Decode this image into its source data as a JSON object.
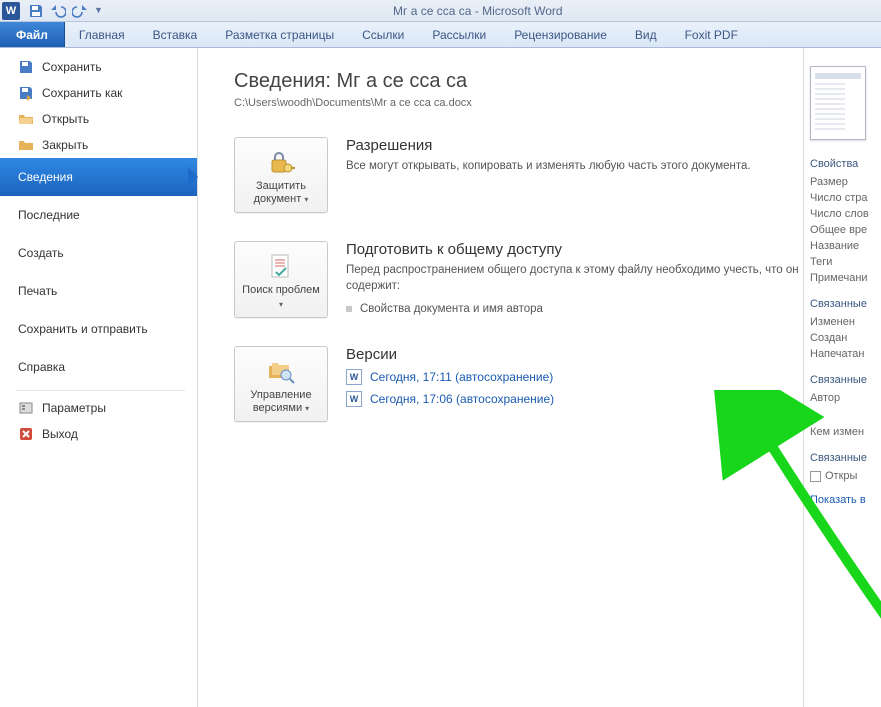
{
  "title": "Мг а се  сса са  -  Microsoft Word",
  "ribbon": {
    "file": "Файл",
    "tabs": [
      "Главная",
      "Вставка",
      "Разметка страницы",
      "Ссылки",
      "Рассылки",
      "Рецензирование",
      "Вид",
      "Foxit PDF"
    ]
  },
  "sidebar": {
    "save": "Сохранить",
    "saveas": "Сохранить как",
    "open": "Открыть",
    "close": "Закрыть",
    "info": "Сведения",
    "recent": "Последние",
    "new": "Создать",
    "print": "Печать",
    "share": "Сохранить и отправить",
    "help": "Справка",
    "options": "Параметры",
    "exit": "Выход"
  },
  "main": {
    "title": "Сведения: Мг а се  сса са",
    "path": "C:\\Users\\woodh\\Documents\\Mr a ce  cca ca.docx",
    "protect": {
      "btn": "Защитить документ",
      "title": "Разрешения",
      "text": "Все могут открывать, копировать и изменять любую часть этого документа."
    },
    "inspect": {
      "btn": "Поиск проблем",
      "title": "Подготовить к общему доступу",
      "text": "Перед распространением общего доступа к этому файлу необходимо учесть, что он содержит:",
      "bullet": "Свойства документа и имя автора"
    },
    "versions": {
      "btn": "Управление версиями",
      "title": "Версии",
      "items": [
        "Сегодня, 17:11 (автосохранение)",
        "Сегодня, 17:06 (автосохранение)"
      ]
    }
  },
  "right": {
    "props": "Свойства",
    "lines1": [
      "Размер",
      "Число стра",
      "Число слов",
      "Общее вре",
      "Название",
      "Теги",
      "Примечани"
    ],
    "related": "Связанные",
    "lines2": [
      "Изменен",
      "Создан",
      "Напечатан"
    ],
    "people": "Связанные",
    "lines3": [
      "Автор",
      "",
      "Кем измен"
    ],
    "docs": "Связанные",
    "openloc": "Откры",
    "showall": "Показать в"
  }
}
